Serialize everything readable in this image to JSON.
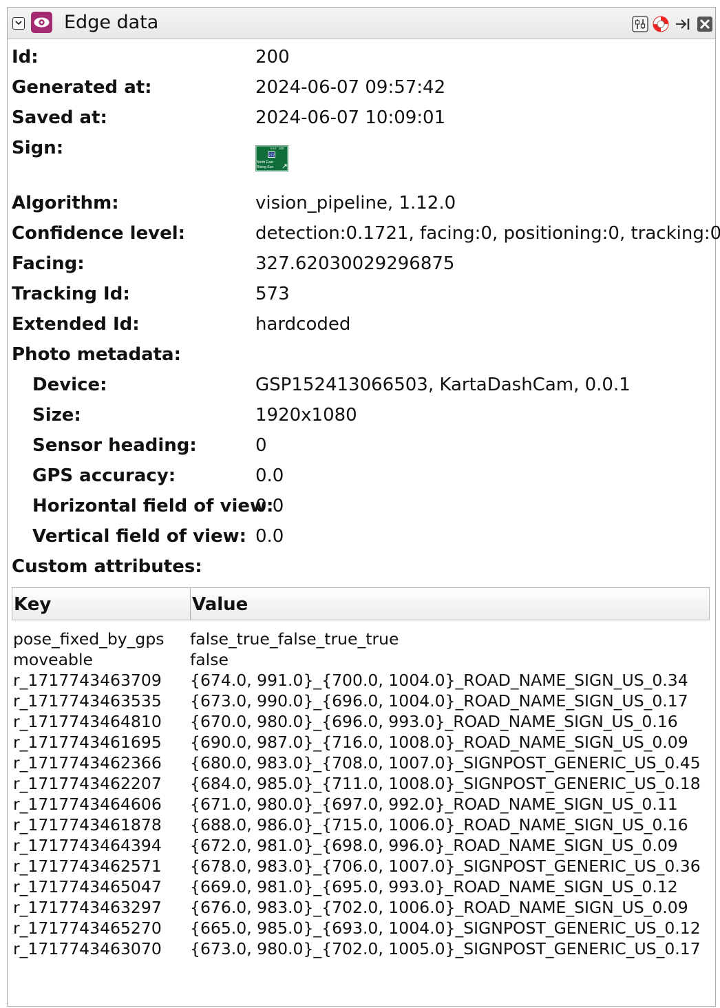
{
  "panel": {
    "title": "Edge data",
    "icons": [
      "collapse-chevron-icon",
      "eye-icon",
      "settings-icon",
      "help-lifebuoy-icon",
      "dock-pin-icon",
      "close-icon"
    ],
    "accent": "#a42a72"
  },
  "fields": {
    "id": {
      "label": "Id:",
      "value": "200"
    },
    "generated_at": {
      "label": "Generated at:",
      "value": "2024-06-07 09:57:42"
    },
    "saved_at": {
      "label": "Saved at:",
      "value": "2024-06-07 10:09:01"
    },
    "sign": {
      "label": "Sign:",
      "image": {
        "exit_text": "EXIT",
        "exit_number": "100",
        "route": "272",
        "line1": "North East",
        "line2": "Rising Sun",
        "color": "#0f6e3a"
      }
    },
    "algorithm": {
      "label": "Algorithm:",
      "value": "vision_pipeline, 1.12.0"
    },
    "confidence": {
      "label": "Confidence level:",
      "value": "detection:0.1721, facing:0, positioning:0, tracking:0"
    },
    "facing": {
      "label": "Facing:",
      "value": "327.62030029296875"
    },
    "tracking_id": {
      "label": "Tracking Id:",
      "value": "573"
    },
    "extended_id": {
      "label": "Extended Id:",
      "value": "hardcoded"
    },
    "photo_metadata": {
      "label": "Photo metadata:"
    },
    "device": {
      "label": "Device:",
      "value": "GSP152413066503, KartaDashCam, 0.0.1"
    },
    "size": {
      "label": "Size:",
      "value": "1920x1080"
    },
    "sensor_heading": {
      "label": "Sensor heading:",
      "value": "0"
    },
    "gps_accuracy": {
      "label": "GPS accuracy:",
      "value": "0.0"
    },
    "hfov": {
      "label": "Horizontal field of view:",
      "value": "0.0"
    },
    "vfov": {
      "label": "Vertical field of view:",
      "value": "0.0"
    },
    "custom_attributes": {
      "label": "Custom attributes:"
    }
  },
  "table": {
    "headers": {
      "key": "Key",
      "value": "Value"
    },
    "rows": [
      {
        "key": "pose_fixed_by_gps",
        "value": "false_true_false_true_true"
      },
      {
        "key": "moveable",
        "value": "false"
      },
      {
        "key": "r_1717743463709",
        "value": "{674.0, 991.0}_{700.0, 1004.0}_ROAD_NAME_SIGN_US_0.34"
      },
      {
        "key": "r_1717743463535",
        "value": "{673.0, 990.0}_{696.0, 1004.0}_ROAD_NAME_SIGN_US_0.17"
      },
      {
        "key": "r_1717743464810",
        "value": "{670.0, 980.0}_{696.0, 993.0}_ROAD_NAME_SIGN_US_0.16"
      },
      {
        "key": "r_1717743461695",
        "value": "{690.0, 987.0}_{716.0, 1008.0}_ROAD_NAME_SIGN_US_0.09"
      },
      {
        "key": "r_1717743462366",
        "value": "{680.0, 983.0}_{708.0, 1007.0}_SIGNPOST_GENERIC_US_0.45"
      },
      {
        "key": "r_1717743462207",
        "value": "{684.0, 985.0}_{711.0, 1008.0}_SIGNPOST_GENERIC_US_0.18"
      },
      {
        "key": "r_1717743464606",
        "value": "{671.0, 980.0}_{697.0, 992.0}_ROAD_NAME_SIGN_US_0.11"
      },
      {
        "key": "r_1717743461878",
        "value": "{688.0, 986.0}_{715.0, 1006.0}_ROAD_NAME_SIGN_US_0.16"
      },
      {
        "key": "r_1717743464394",
        "value": "{672.0, 981.0}_{698.0, 996.0}_ROAD_NAME_SIGN_US_0.09"
      },
      {
        "key": "r_1717743462571",
        "value": "{678.0, 983.0}_{706.0, 1007.0}_SIGNPOST_GENERIC_US_0.36"
      },
      {
        "key": "r_1717743465047",
        "value": "{669.0, 981.0}_{695.0, 993.0}_ROAD_NAME_SIGN_US_0.12"
      },
      {
        "key": "r_1717743463297",
        "value": "{676.0, 983.0}_{702.0, 1006.0}_ROAD_NAME_SIGN_US_0.09"
      },
      {
        "key": "r_1717743465270",
        "value": "{665.0, 985.0}_{693.0, 1004.0}_SIGNPOST_GENERIC_US_0.12"
      },
      {
        "key": "r_1717743463070",
        "value": "{673.0, 980.0}_{702.0, 1005.0}_SIGNPOST_GENERIC_US_0.17"
      }
    ]
  }
}
